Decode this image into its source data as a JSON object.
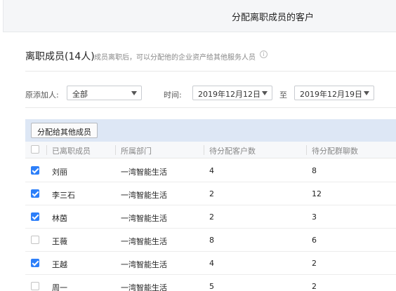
{
  "window": {
    "title": "分配离职成员的客户"
  },
  "header": {
    "title": "离职成员(14人)",
    "description": "成员离职后，可以分配他的企业资产给其他服务人员"
  },
  "filters": {
    "source_label": "原添加人:",
    "source_value": "全部",
    "time_label": "时间:",
    "start_date": "2019年12月12日",
    "range_separator": "至",
    "end_date": "2019年12月19日"
  },
  "toolbar": {
    "assign_label": "分配给其他成员"
  },
  "table": {
    "columns": [
      "已离职成员",
      "所属部门",
      "待分配客户数",
      "待分配群聊数"
    ],
    "rows": [
      {
        "checked": true,
        "name": "刘丽",
        "dept": "一湾智能生活",
        "customers": "4",
        "groups": "8"
      },
      {
        "checked": true,
        "name": "李三石",
        "dept": "一湾智能生活",
        "customers": "2",
        "groups": "12"
      },
      {
        "checked": true,
        "name": "林茵",
        "dept": "一湾智能生活",
        "customers": "2",
        "groups": "3"
      },
      {
        "checked": false,
        "name": "王薇",
        "dept": "一湾智能生活",
        "customers": "8",
        "groups": "6"
      },
      {
        "checked": true,
        "name": "王越",
        "dept": "一湾智能生活",
        "customers": "4",
        "groups": "2"
      },
      {
        "checked": false,
        "name": "周一",
        "dept": "一湾智能生活",
        "customers": "5",
        "groups": "2"
      }
    ]
  },
  "colors": {
    "accent": "#2d7ff9",
    "toolbar_bg": "#dde7f5"
  }
}
